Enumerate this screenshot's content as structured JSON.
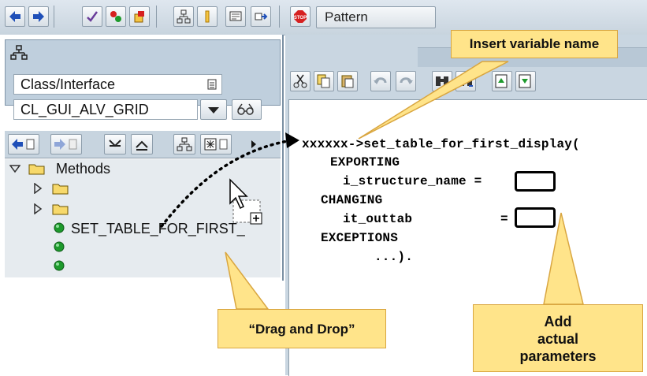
{
  "toolbar": {
    "pattern_label": "Pattern",
    "icons": [
      "back-icon",
      "forward-icon",
      "check-icon",
      "activate-icon",
      "object-list-icon",
      "hierarchy-icon",
      "where-used-icon",
      "display-icon",
      "navigate-icon",
      "stop-icon"
    ]
  },
  "left_panel": {
    "object_type": "Class/Interface",
    "object_name": "CL_GUI_ALV_GRID",
    "tree": {
      "folder_label": "Methods",
      "method_name": "SET_TABLE_FOR_FIRST_"
    }
  },
  "editor": {
    "lines": {
      "l1": "xxxxxx->set_table_for_first_display(",
      "l2": "EXPORTING",
      "l3": "i_structure_name =",
      "l4": "CHANGING",
      "l5": "it_outtab",
      "l5b": "=",
      "l6": "EXCEPTIONS",
      "l7": "...)."
    }
  },
  "callouts": {
    "insert_variable": "Insert variable name",
    "drag_drop": "“Drag and Drop”",
    "add_params": [
      "Add",
      "actual",
      "parameters"
    ]
  },
  "colors": {
    "callout_fill": "#ffe48a",
    "callout_border": "#d9a640",
    "panel_blue": "#c9d6e1",
    "stop_red": "#d62020",
    "nav_blue": "#1f4fb8",
    "method_green": "#1d9a2c"
  }
}
